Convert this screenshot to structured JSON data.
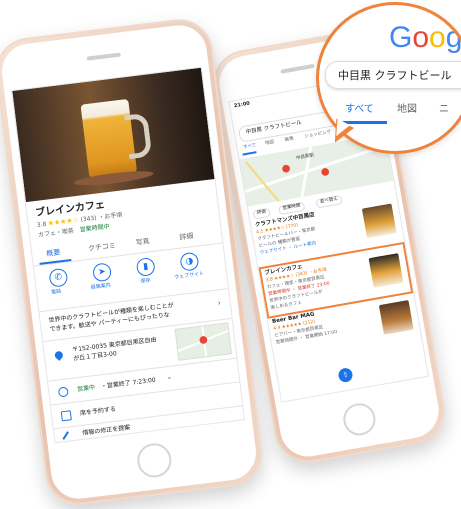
{
  "left_phone": {
    "place_name": "ブレインカフェ",
    "rating": "3.8",
    "stars": "★★★★☆",
    "review_count": "(343)",
    "price": "・お手頃",
    "category": "カフェ・喫茶",
    "status_open": "営業時間中",
    "tabs": [
      "概要",
      "クチコミ",
      "写真",
      "詳細"
    ],
    "actions": [
      "電話",
      "経路案内",
      "保存",
      "ウェブサイト"
    ],
    "description_line1": "世界中のクラフトビールが種類を楽しむことが",
    "description_line2": "できます。歓送や パーティーにもぴったりな",
    "address_line1": "〒152-0035 東京都目黒区自由",
    "address_line2": "が丘１丁目3-00",
    "hours_status": "営業中",
    "hours_text": "・営業終了 7:23:00",
    "reserve": "席を予約する",
    "suggest_edit": "情報の修正を提案"
  },
  "right_phone": {
    "status_time": "21:00",
    "query": "中目黒 クラフトビール",
    "search_tabs": [
      "すべて",
      "地図",
      "画像",
      "ショッピング",
      "動画"
    ],
    "map_label": "中目黒駅",
    "filters": [
      "評価",
      "営業時間",
      "並べ替え"
    ],
    "result1_name": "クラフトマンズ中目黒店",
    "result1_rating": "4.1 ★★★★☆ (770)",
    "result1_line2": "クラフトビールバー・東京都",
    "result1_line3": "ビールの 種類が豊富",
    "result1_line4": "ウェブサイト ・ ルート案内",
    "result2_name": "ブレインカフェ",
    "result2_rating": "3.8 ★★★★☆ (343) ・お手頃",
    "result2_line2": "カフェ・喫茶・東京都目黒区",
    "result2_line3": "営業時間中 ・ 営業終了 23:00",
    "result2_line4": "世界中のクラフトビールが",
    "result2_line5": "楽しめるカフェ",
    "result3_name": "Beer Bar MAG",
    "result3_rating": "4.4 ★★★★★ (212)",
    "result3_line2": "ビアバー・東京都目黒区",
    "result3_line3": "営業時間外 ・ 営業開始 17:00"
  },
  "zoom_bubble": {
    "logo_letters": [
      "G",
      "o",
      "o",
      "g"
    ],
    "logo_colors": [
      "#4285F4",
      "#EA4335",
      "#FBBC05",
      "#4285F4"
    ],
    "query": "中目黒 クラフトビール",
    "tabs": [
      "すべて",
      "地図",
      "ニ"
    ]
  },
  "colors": {
    "accent_blue": "#1a73e8",
    "highlight_orange": "#f0823a",
    "open_green": "#188038"
  }
}
